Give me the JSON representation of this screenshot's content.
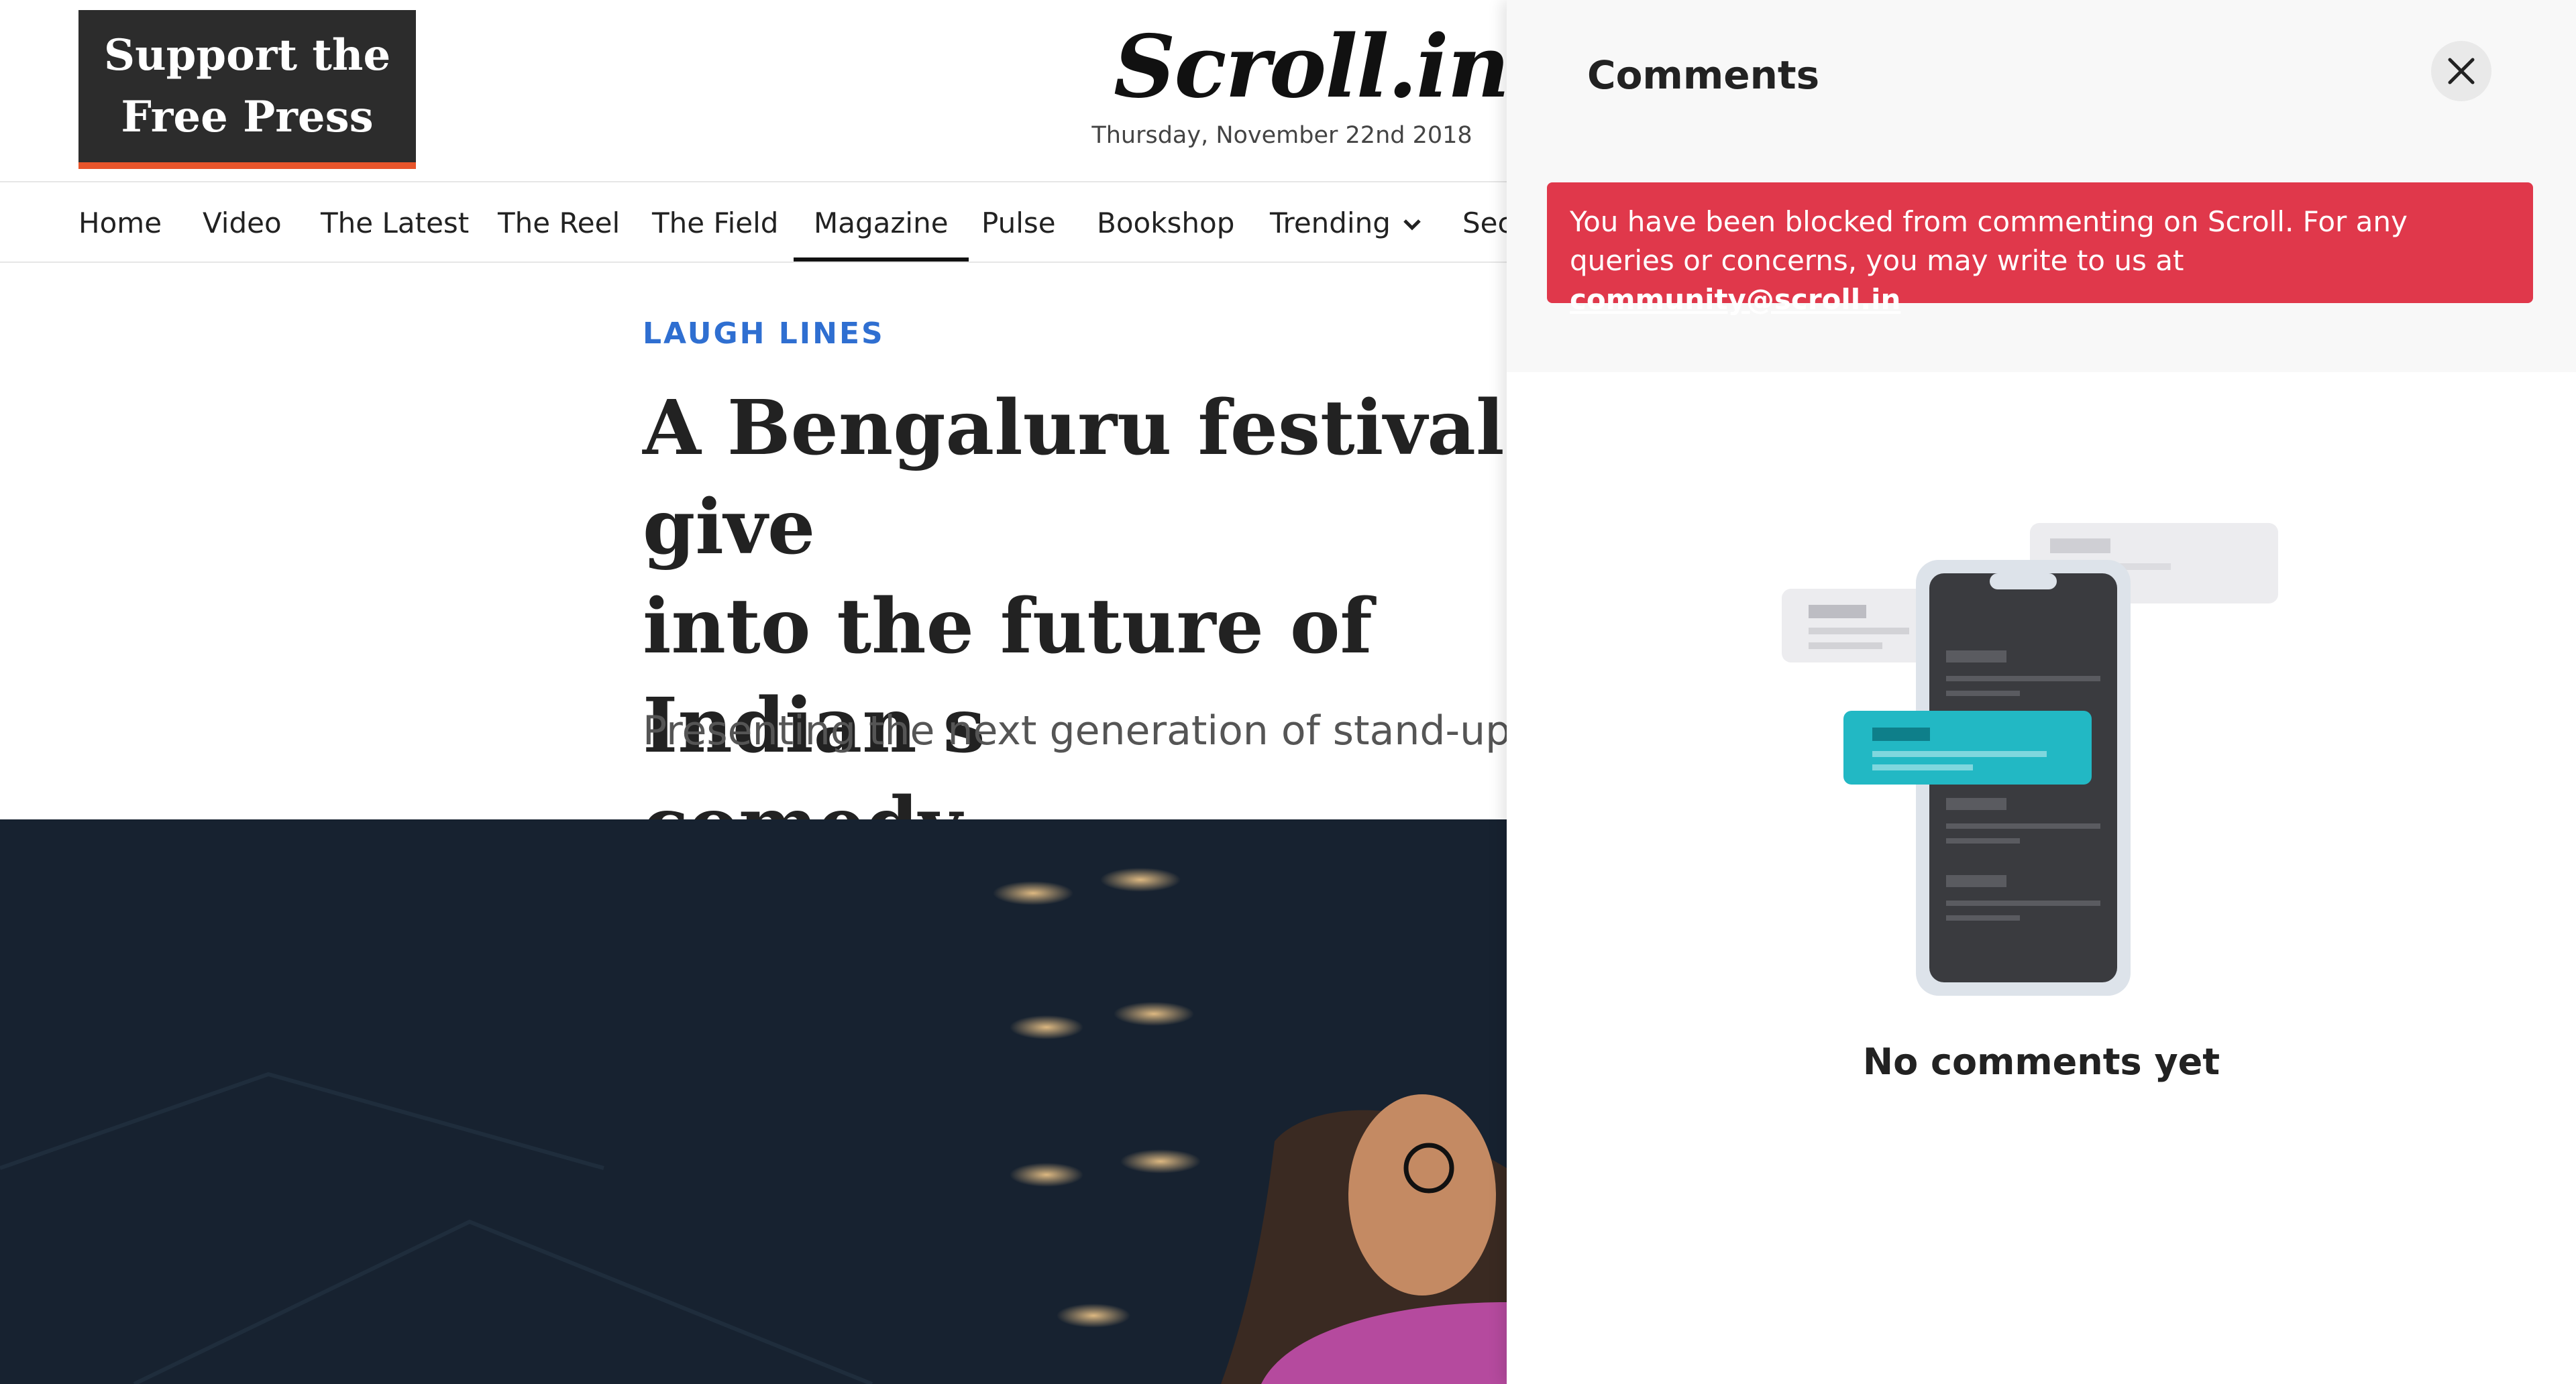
{
  "header": {
    "support_line1": "Support the",
    "support_line2": "Free Press",
    "logo_text": "Scroll.in",
    "date": "Thursday, November 22nd 2018"
  },
  "nav": {
    "items": [
      "Home",
      "Video",
      "The Latest",
      "The Reel",
      "The Field",
      "Magazine",
      "Pulse",
      "Bookshop",
      "Trending",
      "Sec"
    ],
    "active": "Magazine"
  },
  "article": {
    "kicker": "LAUGH LINES",
    "headline": "A Bengaluru festival give\ninto the future of Indian s\ncomedy",
    "dek": "Presenting the next generation of stand-up sta"
  },
  "comments": {
    "title": "Comments",
    "blocked_message": "You have been blocked from commenting on Scroll. For any queries or concerns, you may write to us at",
    "contact_email": "community@scroll.in",
    "empty_state": "No comments yet"
  },
  "colors": {
    "accent_orange": "#e8552b",
    "kicker_blue": "#2f6fd1",
    "alert_red": "#e0384b",
    "hero_navy": "#172230",
    "bubble_teal": "#22b8c4"
  }
}
